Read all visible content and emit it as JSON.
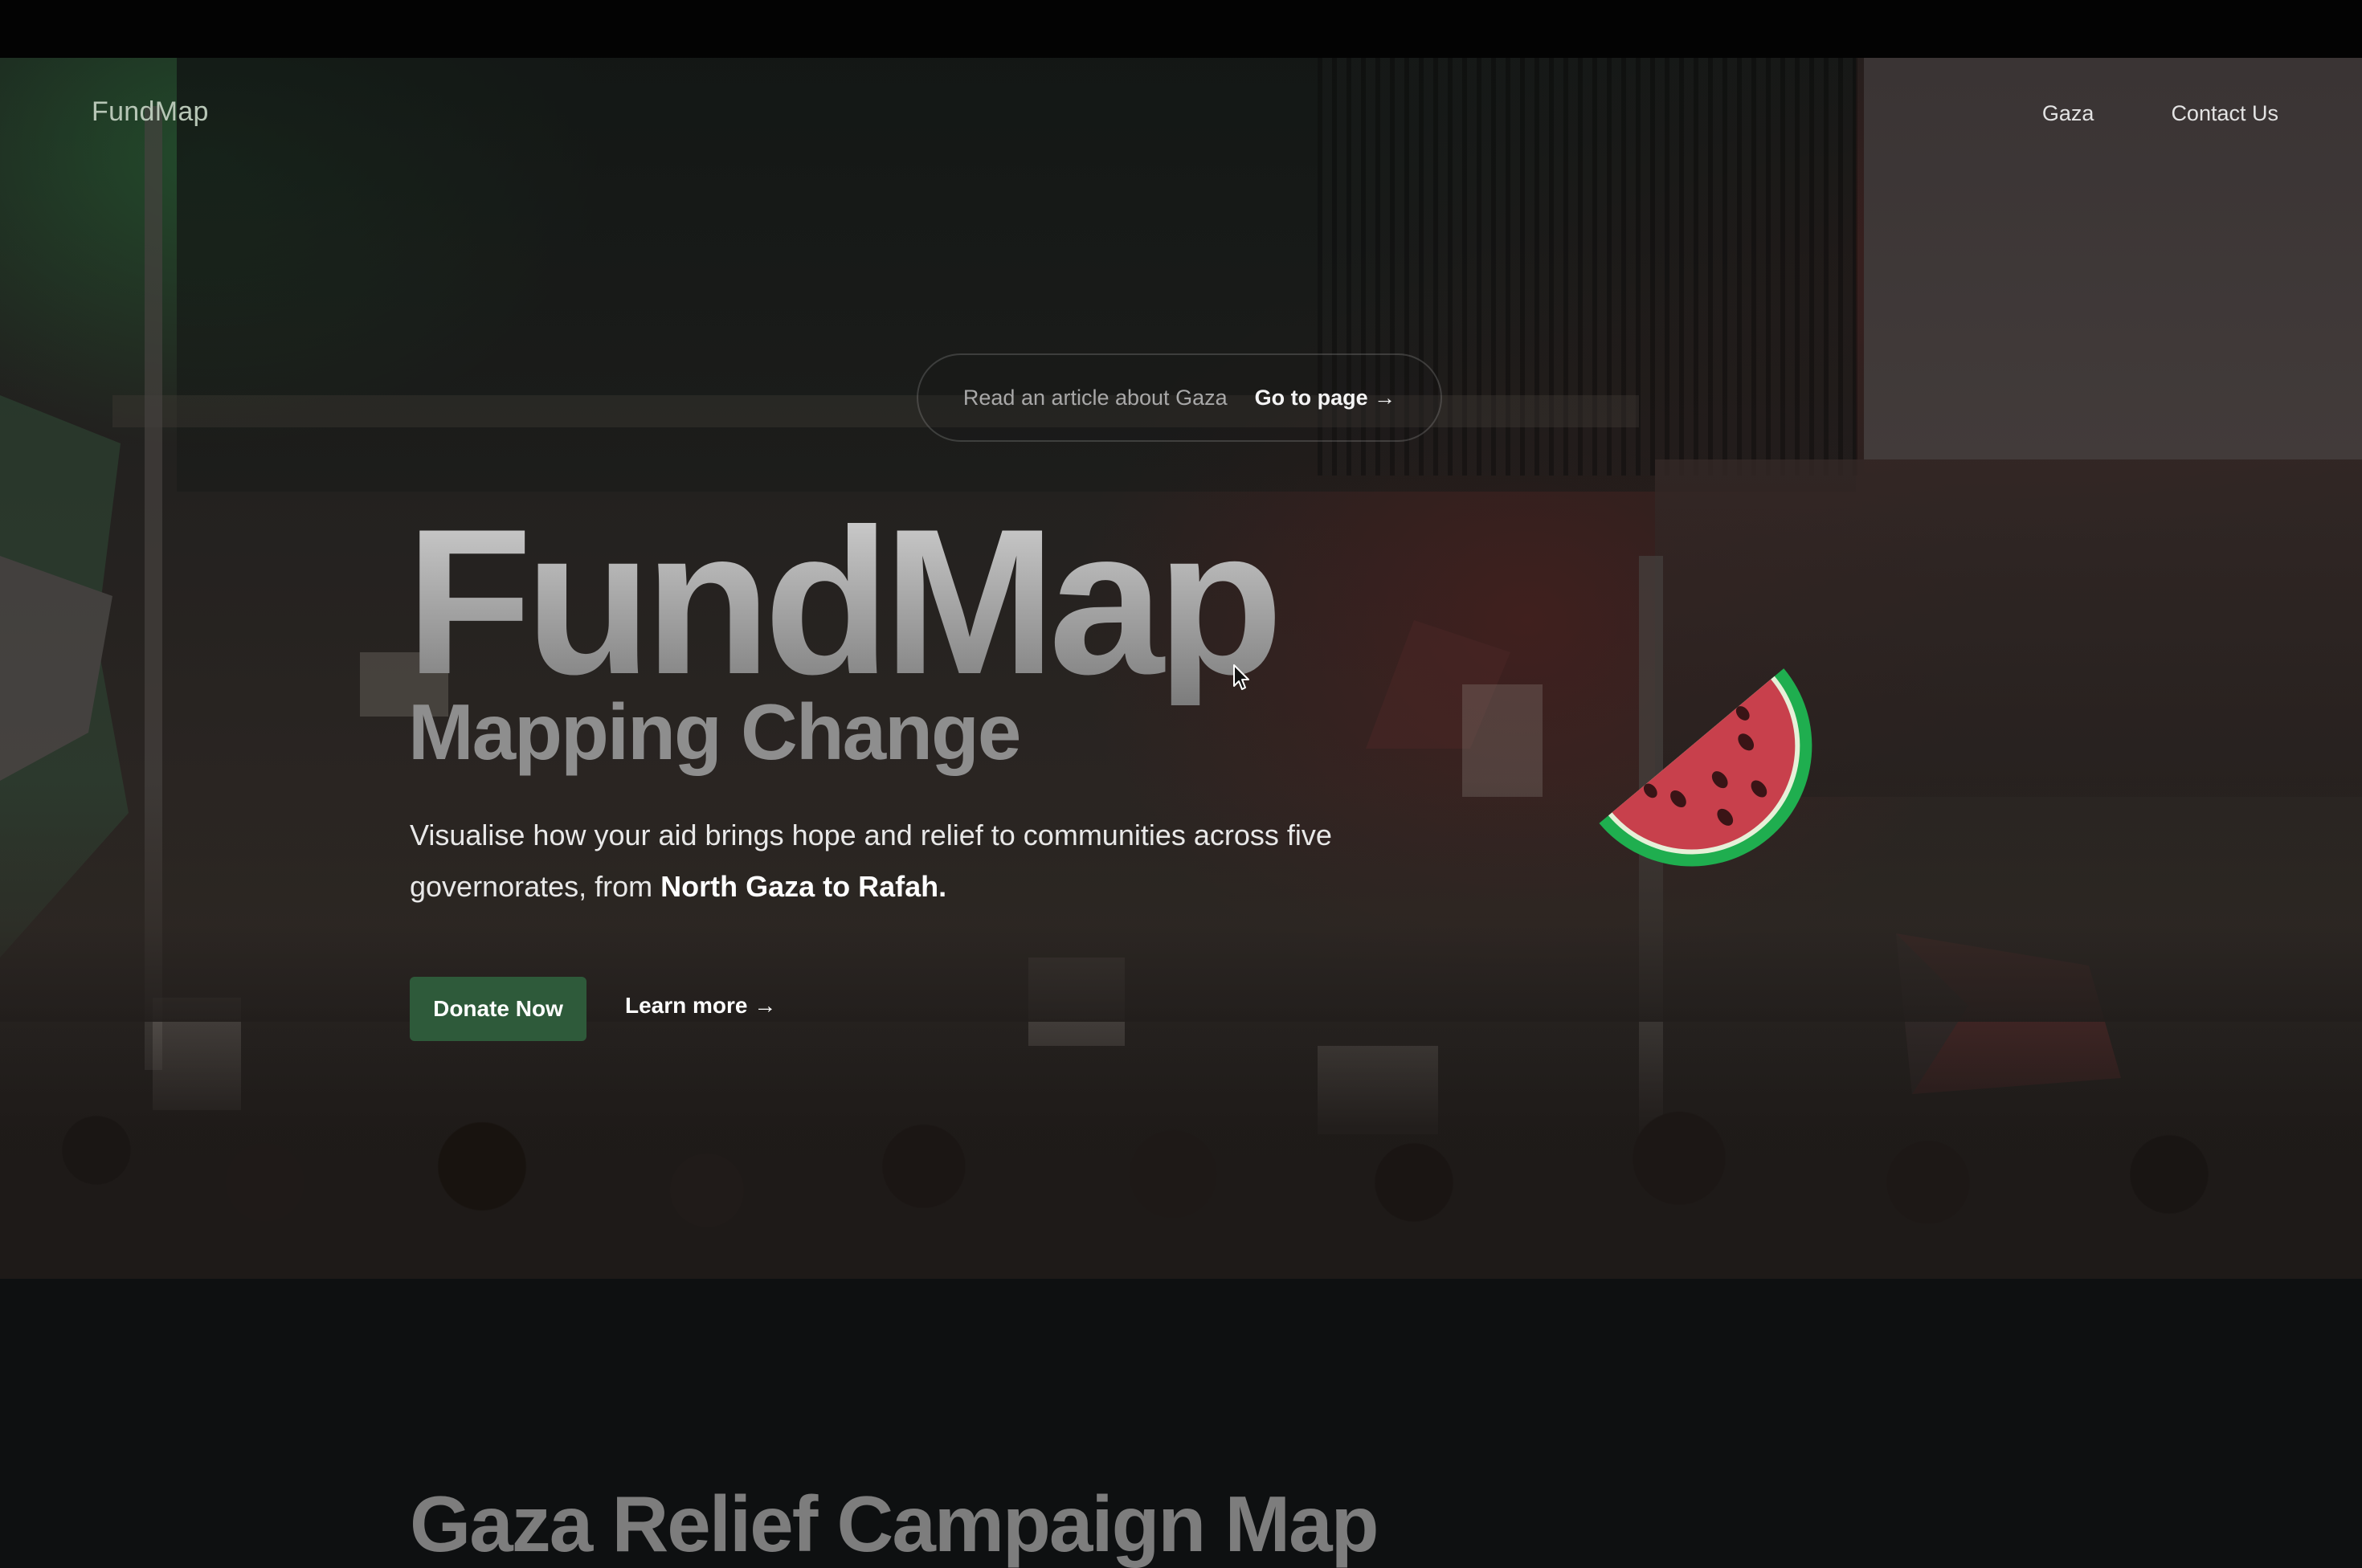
{
  "nav": {
    "brand": "FundMap",
    "links": [
      "Gaza",
      "Contact Us"
    ]
  },
  "announcement": {
    "text": "Read an article about Gaza",
    "link_label": "Go to page →"
  },
  "hero": {
    "title": "FundMap",
    "subtitle": "Mapping Change",
    "description_prefix": "Visualise how your aid brings hope and relief to communities across five governorates, from ",
    "description_bold": "North Gaza to Rafah.",
    "primary_button": "Donate Now",
    "secondary_link": "Learn more →",
    "image_icon": "watermelon-icon"
  },
  "section": {
    "title": "Gaza Relief Campaign Map"
  },
  "colors": {
    "accent": "#2e5a3a",
    "background": "#0e1011",
    "melon_rind": "#1fae4f",
    "melon_flesh": "#c8404c"
  }
}
